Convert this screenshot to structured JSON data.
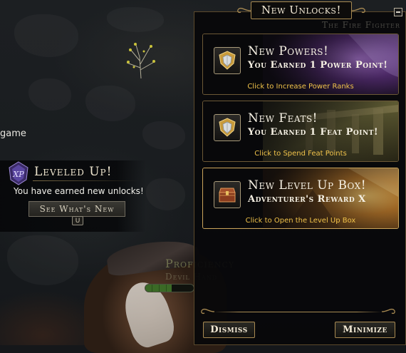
{
  "background": {
    "partial_text_game": "game",
    "proficiency_text": "Proficiency",
    "devil_text": "Devil Hand",
    "watermark_text": "The Fire Fighter",
    "proficiency_fill": 0.55
  },
  "leveled_up": {
    "badge_text": "XP",
    "title": "Leveled Up!",
    "message": "You have earned new unlocks!",
    "button_label": "See What's New",
    "key_hint": "U"
  },
  "unlocks_panel": {
    "title": "New Unlocks!",
    "cards": [
      {
        "title": "New Powers!",
        "subtitle": "You Earned 1 Power Point!",
        "link": "Click to Increase Power Ranks",
        "icon": "shield-icon"
      },
      {
        "title": "New Feats!",
        "subtitle": "You Earned 1 Feat Point!",
        "link": "Click to Spend Feat Points",
        "icon": "shield-icon"
      },
      {
        "title": "New Level Up Box!",
        "subtitle": "Adventurer's Reward X",
        "link": "Click to Open the Level Up Box",
        "icon": "treasure-chest-icon"
      }
    ],
    "dismiss_label": "Dismiss",
    "minimize_label": "Minimize"
  },
  "colors": {
    "link_gold": "#f0c24a",
    "frame_gold": "#a88a52",
    "panel_bg": "#08080a"
  }
}
